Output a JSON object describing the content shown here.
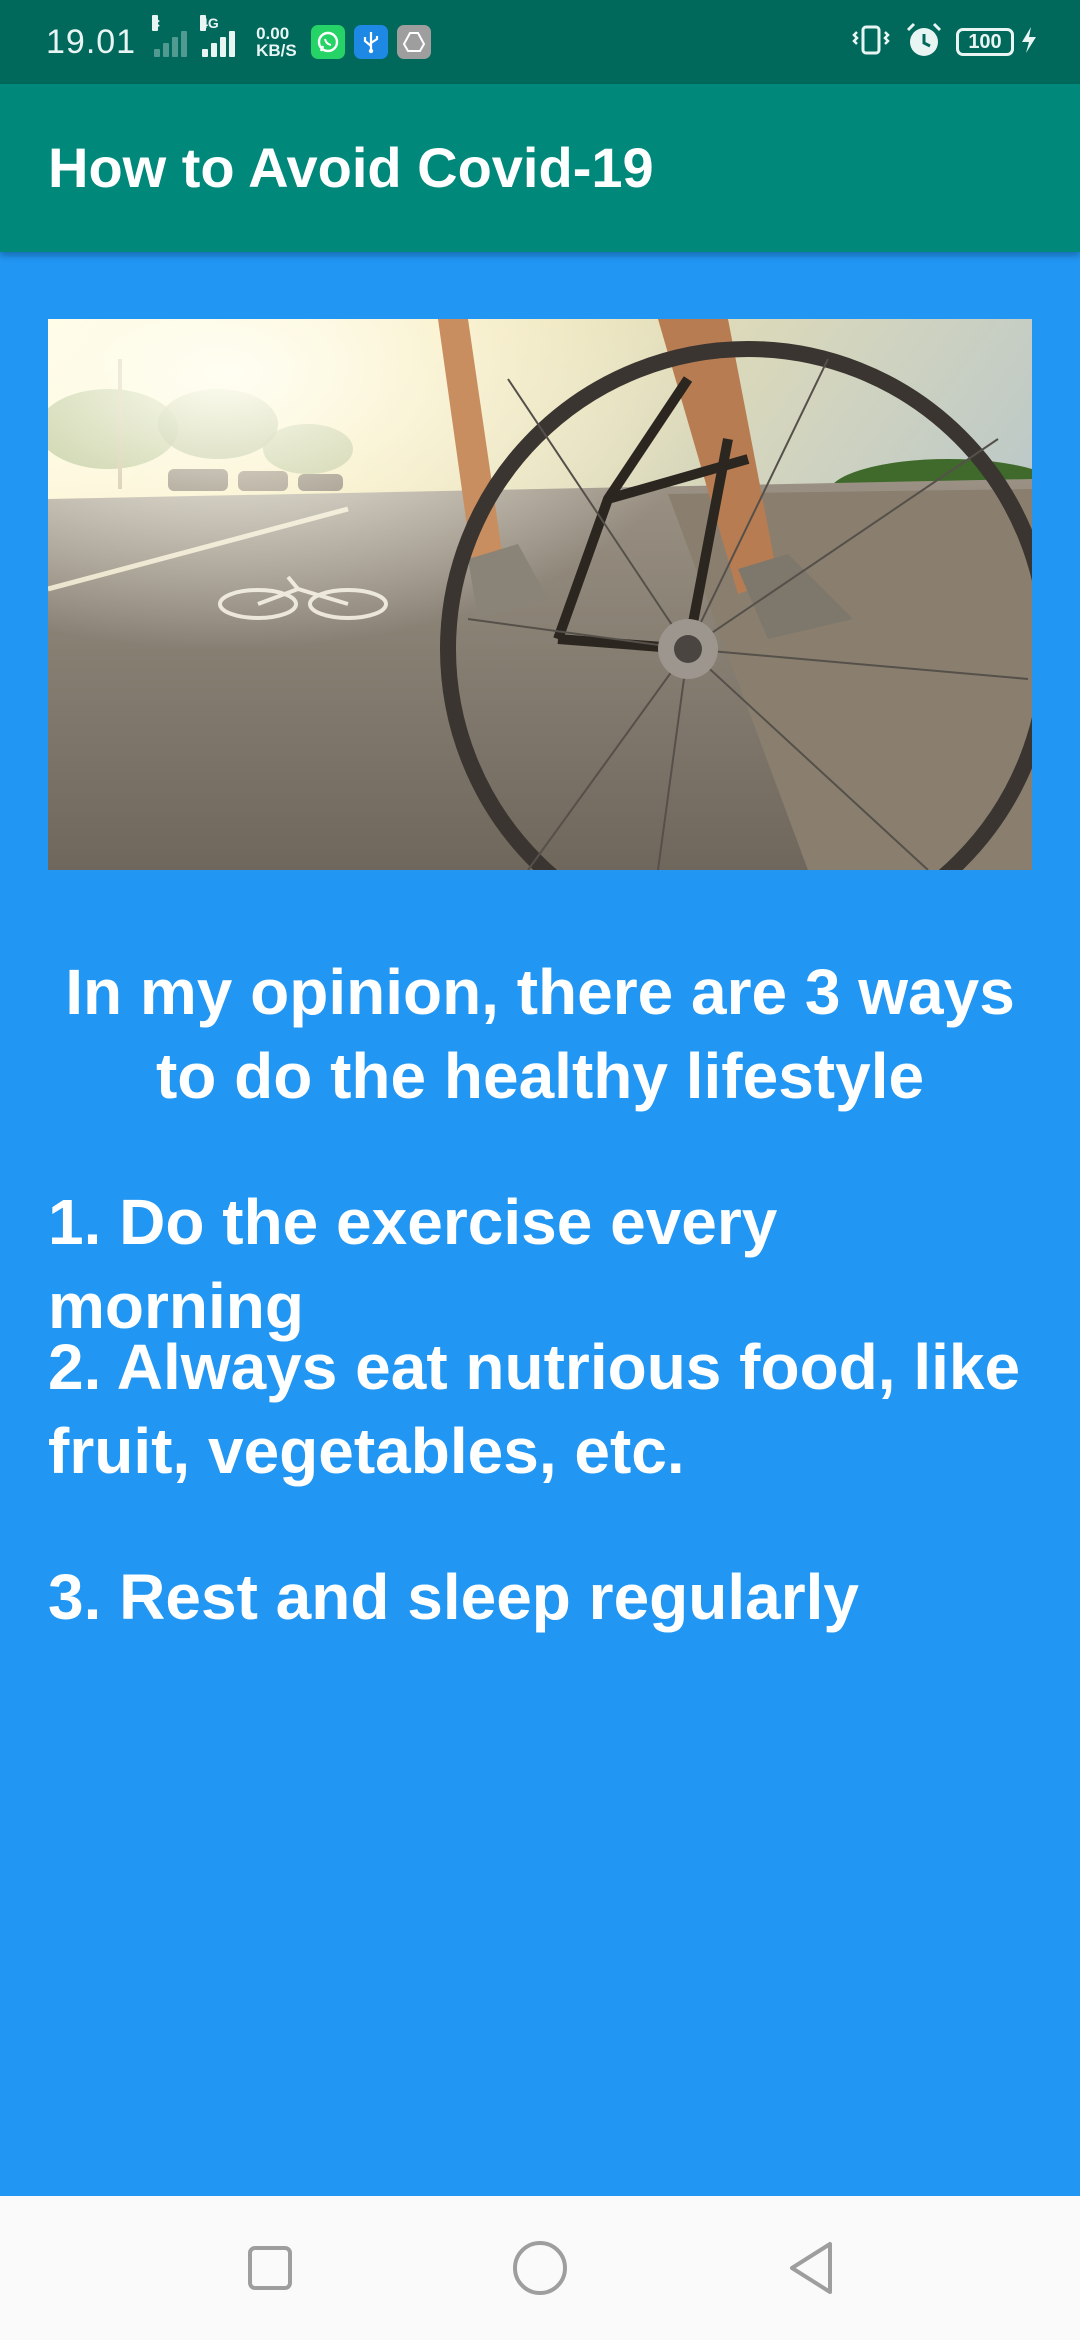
{
  "status_bar": {
    "time": "19.01",
    "network_type": "4G",
    "speed_value": "0.00",
    "speed_unit": "KB/S",
    "battery_level": "100",
    "icons": [
      "signal-icon",
      "whatsapp-icon",
      "usb-icon",
      "drive-icon",
      "vibrate-icon",
      "alarm-icon",
      "battery-icon",
      "charging-icon"
    ]
  },
  "app_bar": {
    "title": "How to Avoid Covid-19"
  },
  "hero_image": {
    "subject": "cyclist-on-bike-lane-photo"
  },
  "content": {
    "intro": "In my opinion, there are 3 ways to do the healthy lifestyle",
    "tips": [
      "1. Do the exercise every morning",
      "2. Always eat nutrious food, like fruit, vegetables, etc.",
      "3. Rest and sleep regularly"
    ]
  },
  "nav_bar": {
    "buttons": [
      "recent-apps-button",
      "home-button",
      "back-button"
    ]
  },
  "colors": {
    "status_bar": "#00695C",
    "app_bar": "#00897B",
    "background": "#2196F3",
    "text": "#FFFFFF",
    "nav_bar": "#FAFAFA"
  }
}
